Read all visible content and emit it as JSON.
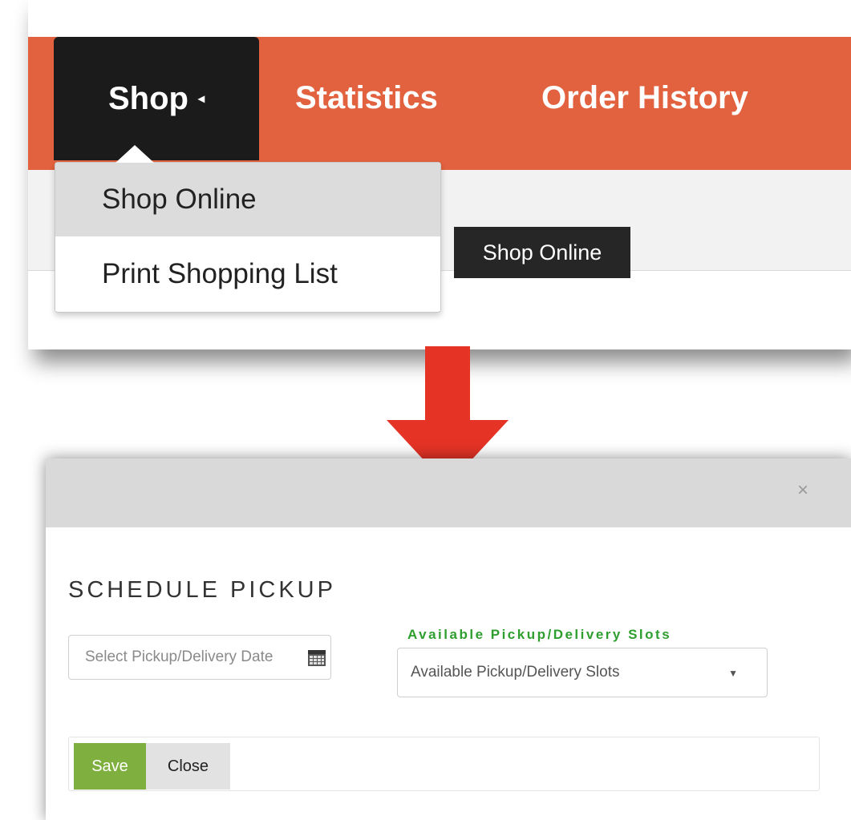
{
  "navbar": {
    "items": [
      {
        "label": "Shop",
        "caret": "◂",
        "active": true
      },
      {
        "label": "Statistics"
      },
      {
        "label": "Order History"
      }
    ],
    "dropdown": [
      "Shop Online",
      "Print Shopping List"
    ],
    "tooltip": "Shop Online",
    "colors": {
      "navbar_bg": "#e2623f",
      "active_tab_bg": "#1b1b1b"
    }
  },
  "arrow": {
    "color": "#e53326",
    "icon": "arrow-down-icon"
  },
  "modal": {
    "close_symbol": "×",
    "title": "SCHEDULE PICKUP",
    "date_placeholder": "Select Pickup/Delivery Date",
    "calendar_icon": "calendar-icon",
    "slots_legend": "Available Pickup/Delivery Slots",
    "slots_selected": "Available Pickup/Delivery Slots",
    "slots_caret": "▼",
    "save_label": "Save",
    "close_label": "Close",
    "colors": {
      "legend": "#2e9e2e",
      "save_bg": "#7fb03f"
    }
  }
}
